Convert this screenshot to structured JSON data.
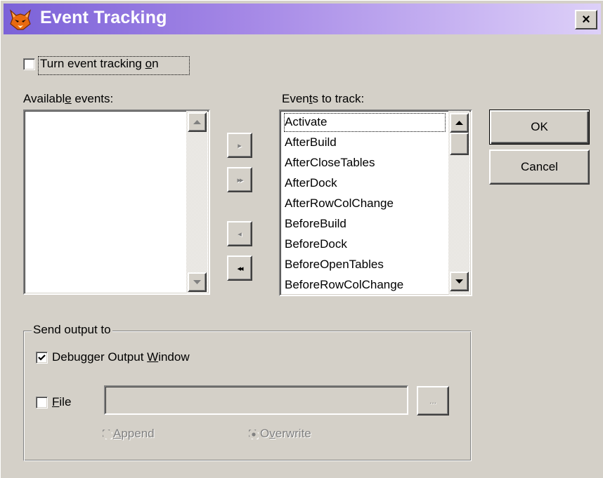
{
  "window": {
    "title": "Event Tracking",
    "close_label": "×",
    "titlebar_gradient": [
      "#7b62d8",
      "#ddd0f8"
    ]
  },
  "tracking": {
    "checkbox_label_pre": "Turn event tracking ",
    "checkbox_label_access": "o",
    "checkbox_label_post": "n",
    "checked": false
  },
  "available": {
    "label_pre": "Availabl",
    "label_access": "e",
    "label_post": " events:",
    "items": []
  },
  "to_track": {
    "label_pre": "Even",
    "label_access": "t",
    "label_post": "s to track:",
    "items": [
      "Activate",
      "AfterBuild",
      "AfterCloseTables",
      "AfterDock",
      "AfterRowColChange",
      "BeforeBuild",
      "BeforeDock",
      "BeforeOpenTables",
      "BeforeRowColChange"
    ],
    "selected_index": 0
  },
  "transfer_buttons": {
    "add_one": "▸",
    "add_all": "▸▸",
    "remove_one": "◂",
    "remove_all": "◂◂"
  },
  "buttons": {
    "ok": "OK",
    "cancel": "Cancel"
  },
  "output": {
    "group_title": "Send output to",
    "debugger_pre": "Debugger Output ",
    "debugger_access": "W",
    "debugger_post": "indow",
    "debugger_checked": true,
    "file_access": "F",
    "file_post": "ile",
    "file_checked": false,
    "file_path": "",
    "browse_label": "...",
    "append_access": "A",
    "append_post": "ppend",
    "overwrite_pre": "O",
    "overwrite_access": "v",
    "overwrite_post": "erwrite",
    "mode_selected": "Overwrite"
  },
  "icons": {
    "app": "fox-icon",
    "close": "close-icon",
    "check": "checkmark-icon",
    "scroll_up": "arrow-up-icon",
    "scroll_down": "arrow-down-icon"
  }
}
